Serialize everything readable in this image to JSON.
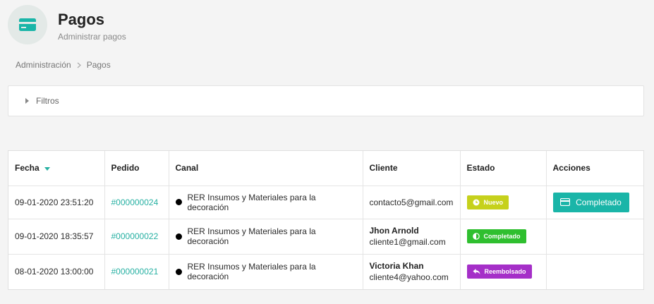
{
  "header": {
    "title": "Pagos",
    "subtitle": "Administrar pagos",
    "icon": "credit-card-icon",
    "accent": "#1ab5a8"
  },
  "breadcrumb": [
    "Administración",
    "Pagos"
  ],
  "filters": {
    "label": "Filtros"
  },
  "table": {
    "columns": [
      "Fecha",
      "Pedido",
      "Canal",
      "Cliente",
      "Estado",
      "Acciones"
    ],
    "sort_column": "Fecha",
    "rows": [
      {
        "fecha": "09-01-2020 23:51:20",
        "pedido": "#000000024",
        "canal": "RER Insumos y Materiales para la decoración",
        "cliente_name": "",
        "cliente_email": "contacto5@gmail.com",
        "estado": "Nuevo",
        "estado_color": "#c6d11c",
        "estado_icon": "clock-icon",
        "accion": "Completado"
      },
      {
        "fecha": "09-01-2020 18:35:57",
        "pedido": "#000000022",
        "canal": "RER Insumos y Materiales para la decoración",
        "cliente_name": "Jhon Arnold",
        "cliente_email": "cliente1@gmail.com",
        "estado": "Completado",
        "estado_color": "#2fbf2f",
        "estado_icon": "half-circle-icon",
        "accion": ""
      },
      {
        "fecha": "08-01-2020 13:00:00",
        "pedido": "#000000021",
        "canal": "RER Insumos y Materiales para la decoración",
        "cliente_name": "Victoria Khan",
        "cliente_email": "cliente4@yahoo.com",
        "estado": "Reembolsado",
        "estado_color": "#a52fc8",
        "estado_icon": "reply-icon",
        "accion": ""
      }
    ]
  }
}
